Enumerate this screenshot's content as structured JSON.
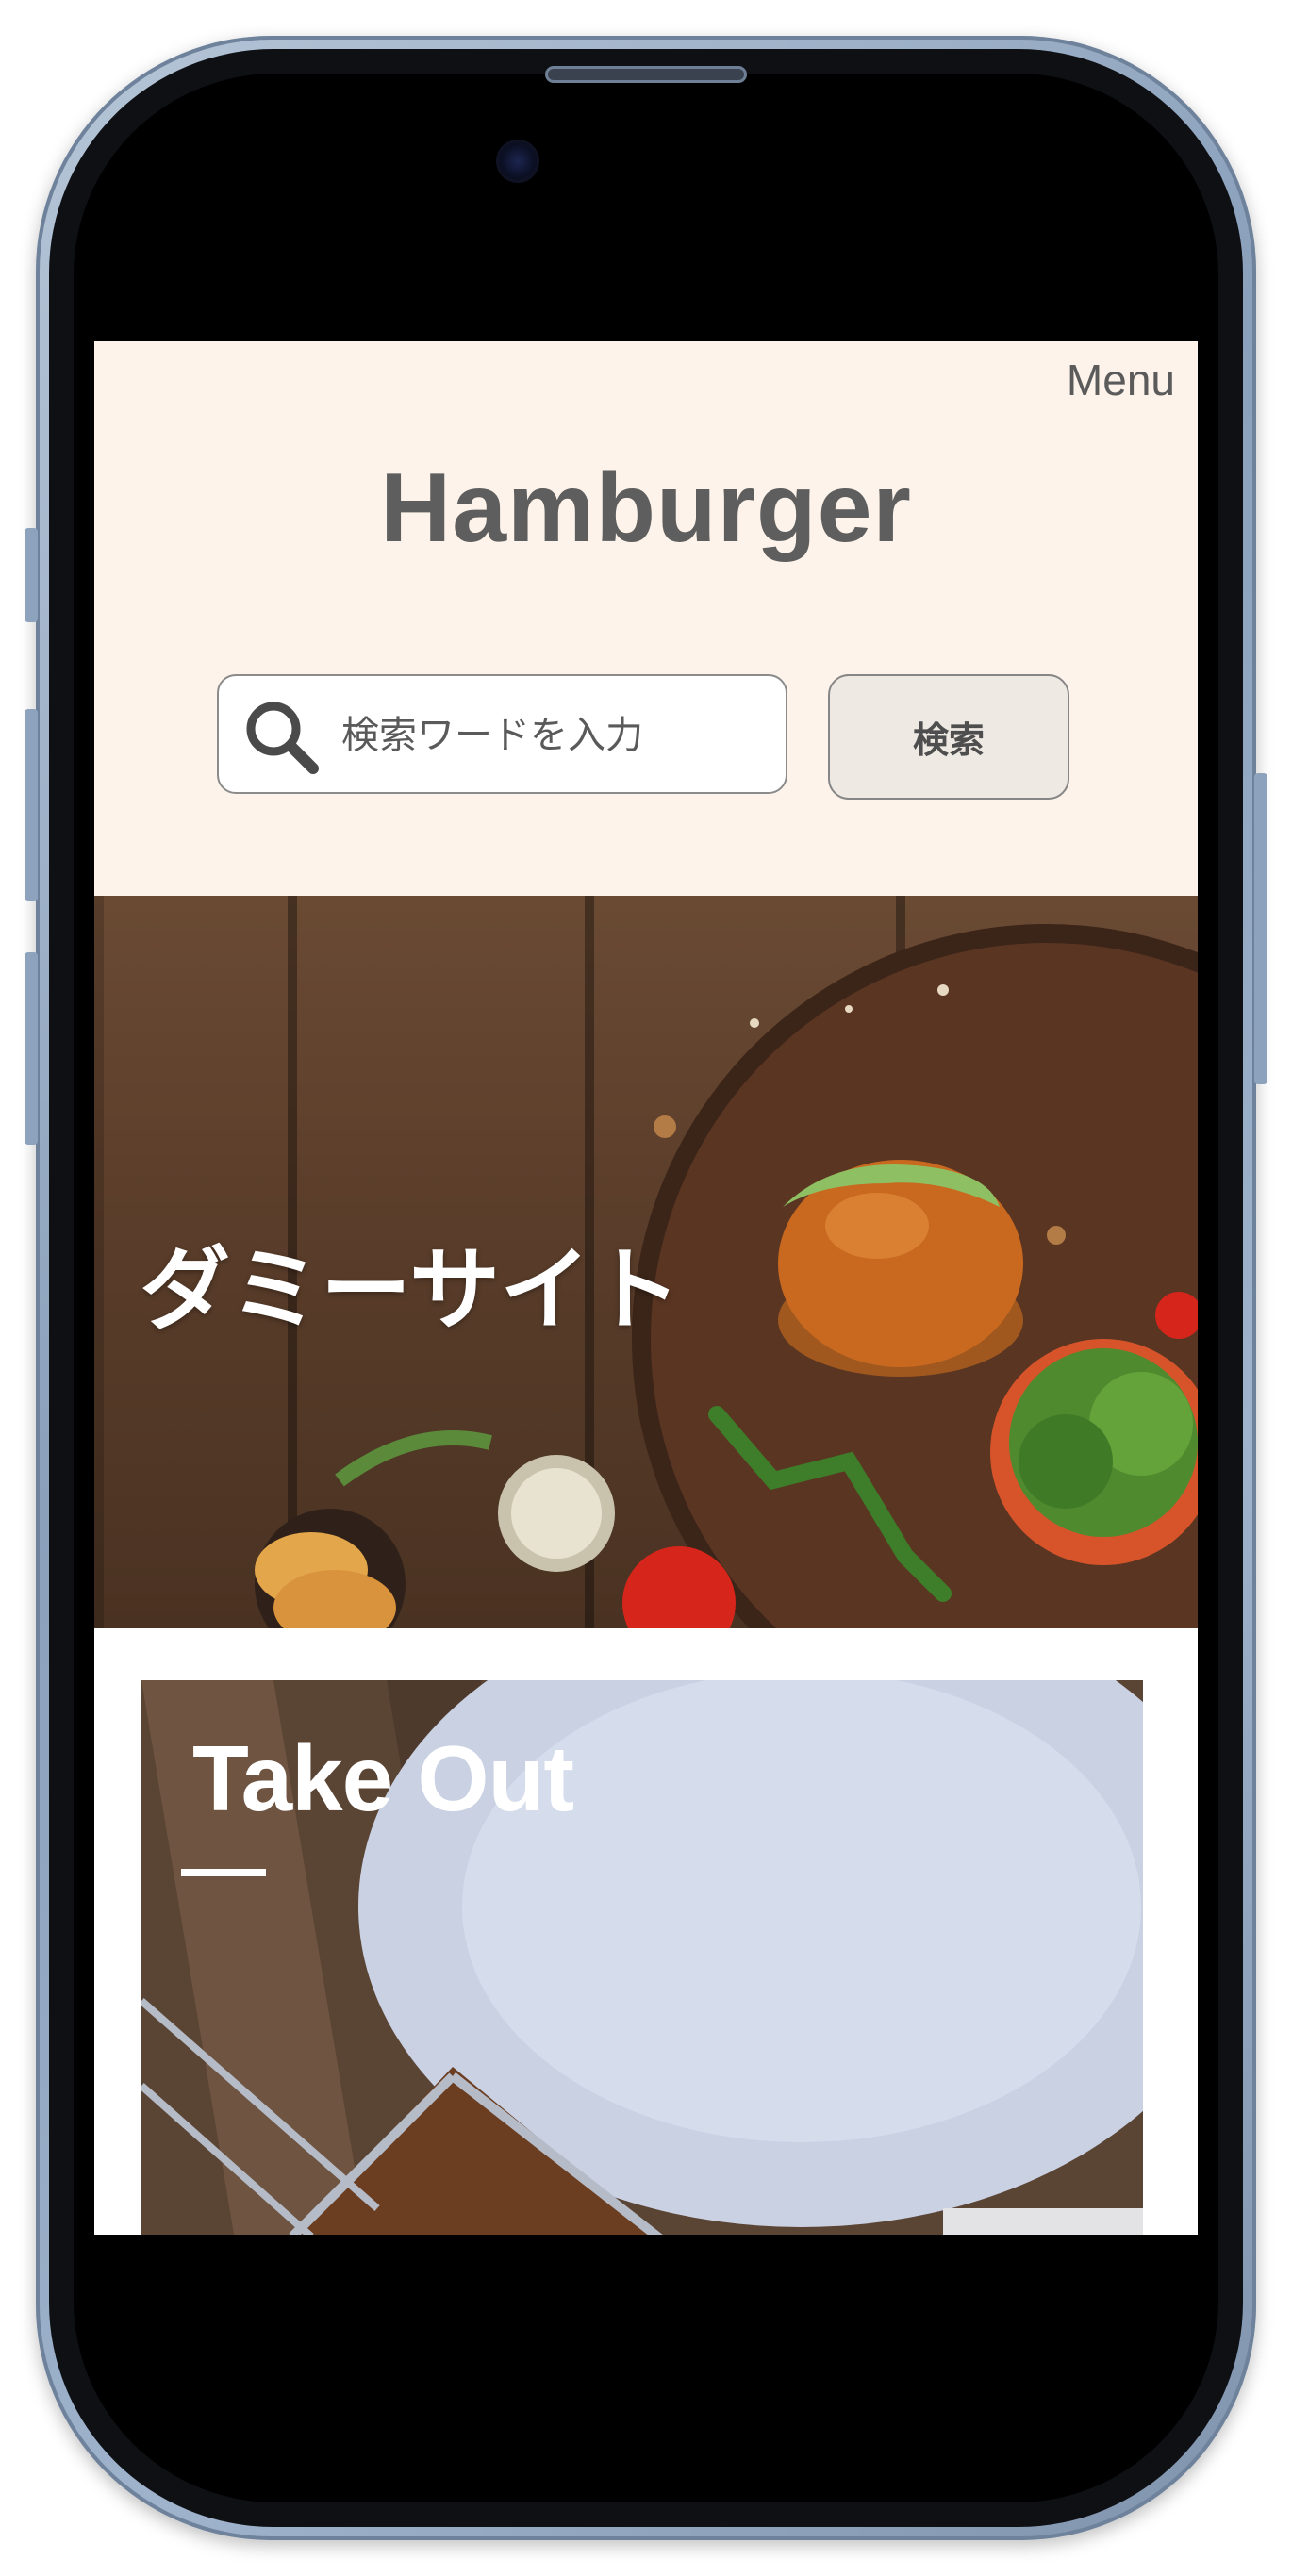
{
  "header": {
    "menu_label": "Menu",
    "site_title": "Hamburger"
  },
  "search": {
    "placeholder": "検索ワードを入力",
    "value": "",
    "button_label": "検索"
  },
  "hero": {
    "title": "ダミーサイト"
  },
  "section": {
    "title": "Take Out"
  },
  "icons": {
    "search": "search-icon"
  },
  "colors": {
    "header_bg": "#fdf3ea",
    "text": "#5e5e5e",
    "button_bg": "#efe9e4"
  }
}
